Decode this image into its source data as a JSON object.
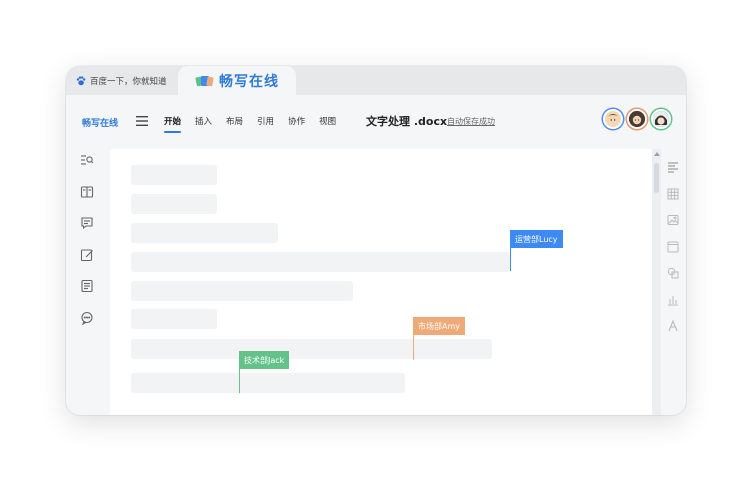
{
  "browser": {
    "tab_inactive_label": "百度一下，你就知道",
    "tab_active_title": "畅写在线"
  },
  "toolbar": {
    "brand": "畅写在线",
    "menu": [
      "开始",
      "插入",
      "布局",
      "引用",
      "协作",
      "视图"
    ],
    "active_menu": "开始",
    "doc_title": "文字处理 .docx",
    "save_status": "自动保存成功"
  },
  "collaborators": [
    {
      "label": "运营部Lucy",
      "color": "#3d8af7"
    },
    {
      "label": "市场部Amy",
      "color": "#f0aa77"
    },
    {
      "label": "技术部Jack",
      "color": "#62c28a"
    }
  ],
  "left_sidebar_icons": [
    "search-list-icon",
    "book-icon",
    "comment-icon",
    "edit-icon",
    "document-icon",
    "chat-icon"
  ],
  "right_sidebar_icons": [
    "paragraph-icon",
    "table-icon",
    "image-icon",
    "header-footer-icon",
    "shape-icon",
    "chart-icon",
    "text-art-icon"
  ],
  "colors": {
    "accent": "#2f7bd8"
  }
}
